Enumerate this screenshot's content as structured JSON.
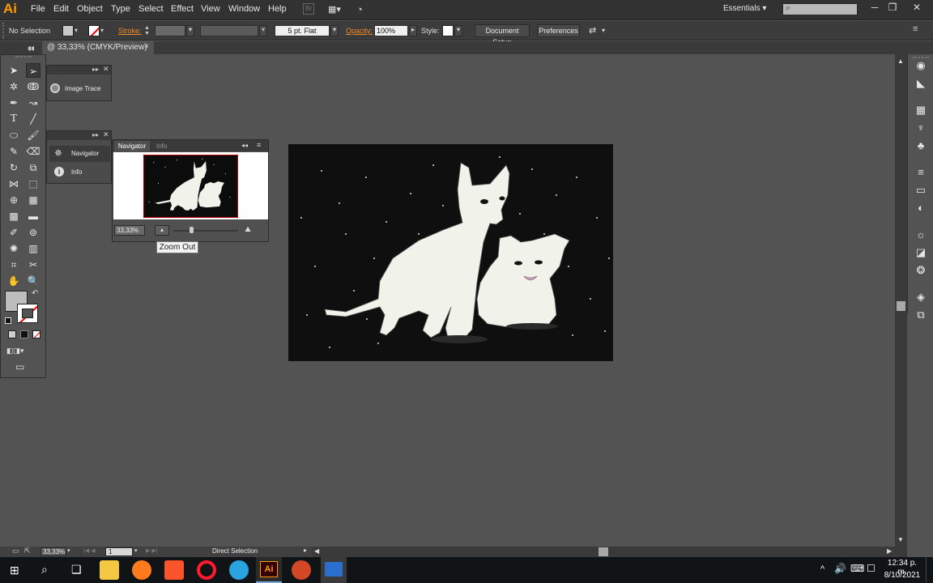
{
  "app": {
    "logo": "Ai",
    "menu": [
      "File",
      "Edit",
      "Object",
      "Type",
      "Select",
      "Effect",
      "View",
      "Window",
      "Help"
    ],
    "workspace": "Essentials",
    "search_placeholder": ""
  },
  "control_bar": {
    "selection": "No Selection",
    "stroke_label": "Stroke:",
    "brush": "5 pt. Flat",
    "opacity_label": "Opacity:",
    "opacity_value": "100%",
    "style_label": "Style:",
    "document_setup": "Document Setup",
    "preferences": "Preferences"
  },
  "document_tab": {
    "title": "@ 33,33% (CMYK/Preview)",
    "close": "×"
  },
  "panels": {
    "image_trace": "Image Trace",
    "dock_items": [
      "Navigator",
      "Info"
    ],
    "navigator": {
      "tabs": [
        "Navigator",
        "Info"
      ],
      "zoom": "33,33%",
      "tooltip": "Zoom Out"
    }
  },
  "status_bar": {
    "zoom": "33,33%",
    "artboard": "1",
    "tool": "Direct Selection"
  },
  "taskbar": {
    "time": "12:34 p. m.",
    "date": "8/10/2021"
  },
  "colors": {
    "brand": "#ff9a00",
    "canvas": "#535353",
    "artboard": "#0f0f0f",
    "cat": "#f1f3ea"
  }
}
